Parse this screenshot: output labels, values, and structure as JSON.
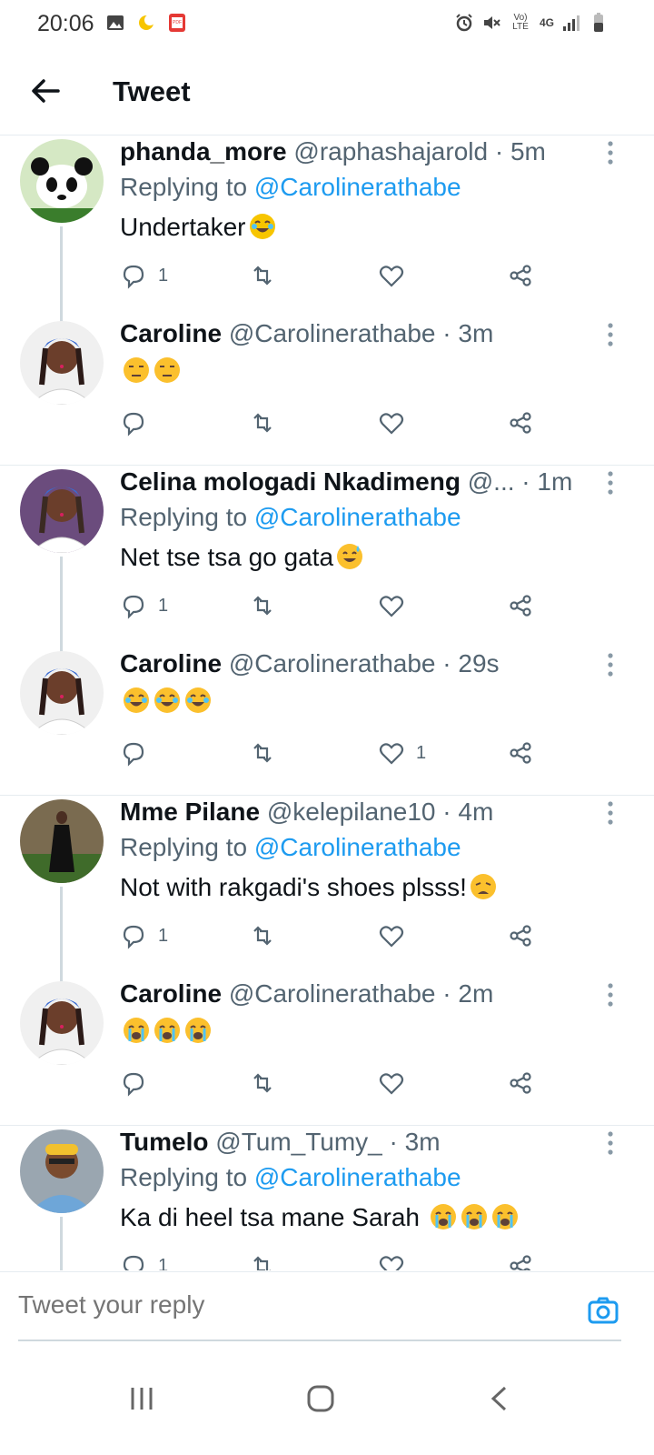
{
  "status_bar": {
    "time": "20:06",
    "network_label": "4G",
    "volte_label": "Vo) LTE"
  },
  "header": {
    "title": "Tweet"
  },
  "tweets": [
    {
      "name": "phanda_more",
      "handle": "@raphashajarold",
      "time": "5m",
      "replying_prefix": "Replying to",
      "replying_to": "@Carolinerathabe",
      "text": "Undertaker",
      "emoji": [
        "rofl"
      ],
      "replies": "1",
      "likes": ""
    },
    {
      "name": "Caroline",
      "handle": "@Carolinerathabe",
      "time": "3m",
      "text": "",
      "emoji": [
        "unamused",
        "unamused"
      ],
      "replies": "",
      "likes": ""
    },
    {
      "name": "Celina mologadi Nkadimeng",
      "handle": "@...",
      "time": "1m",
      "replying_prefix": "Replying to",
      "replying_to": "@Carolinerathabe",
      "text": "Net tse tsa go gata",
      "emoji": [
        "sweat-smile"
      ],
      "replies": "1",
      "likes": ""
    },
    {
      "name": "Caroline",
      "handle": "@Carolinerathabe",
      "time": "29s",
      "text": "",
      "emoji": [
        "joy",
        "joy",
        "joy"
      ],
      "replies": "",
      "likes": "1"
    },
    {
      "name": "Mme Pilane",
      "handle": "@kelepilane10",
      "time": "4m",
      "replying_prefix": "Replying to",
      "replying_to": "@Carolinerathabe",
      "text": "Not with rakgadi's shoes plsss!",
      "emoji": [
        "weary"
      ],
      "replies": "1",
      "likes": ""
    },
    {
      "name": "Caroline",
      "handle": "@Carolinerathabe",
      "time": "2m",
      "text": "",
      "emoji": [
        "sob",
        "sob",
        "sob"
      ],
      "replies": "",
      "likes": ""
    },
    {
      "name": "Tumelo",
      "handle": "@Tum_Tumy_",
      "time": "3m",
      "replying_prefix": "Replying to",
      "replying_to": "@Carolinerathabe",
      "text": "Ka di heel tsa mane Sarah ",
      "emoji": [
        "sob",
        "sob",
        "sob"
      ],
      "replies": "1",
      "likes": ""
    }
  ],
  "reply_bar": {
    "placeholder": "Tweet your reply"
  },
  "colors": {
    "accent": "#1d9bf0",
    "text": "#0f1419",
    "muted": "#536471",
    "divider": "#e6ecf0"
  }
}
